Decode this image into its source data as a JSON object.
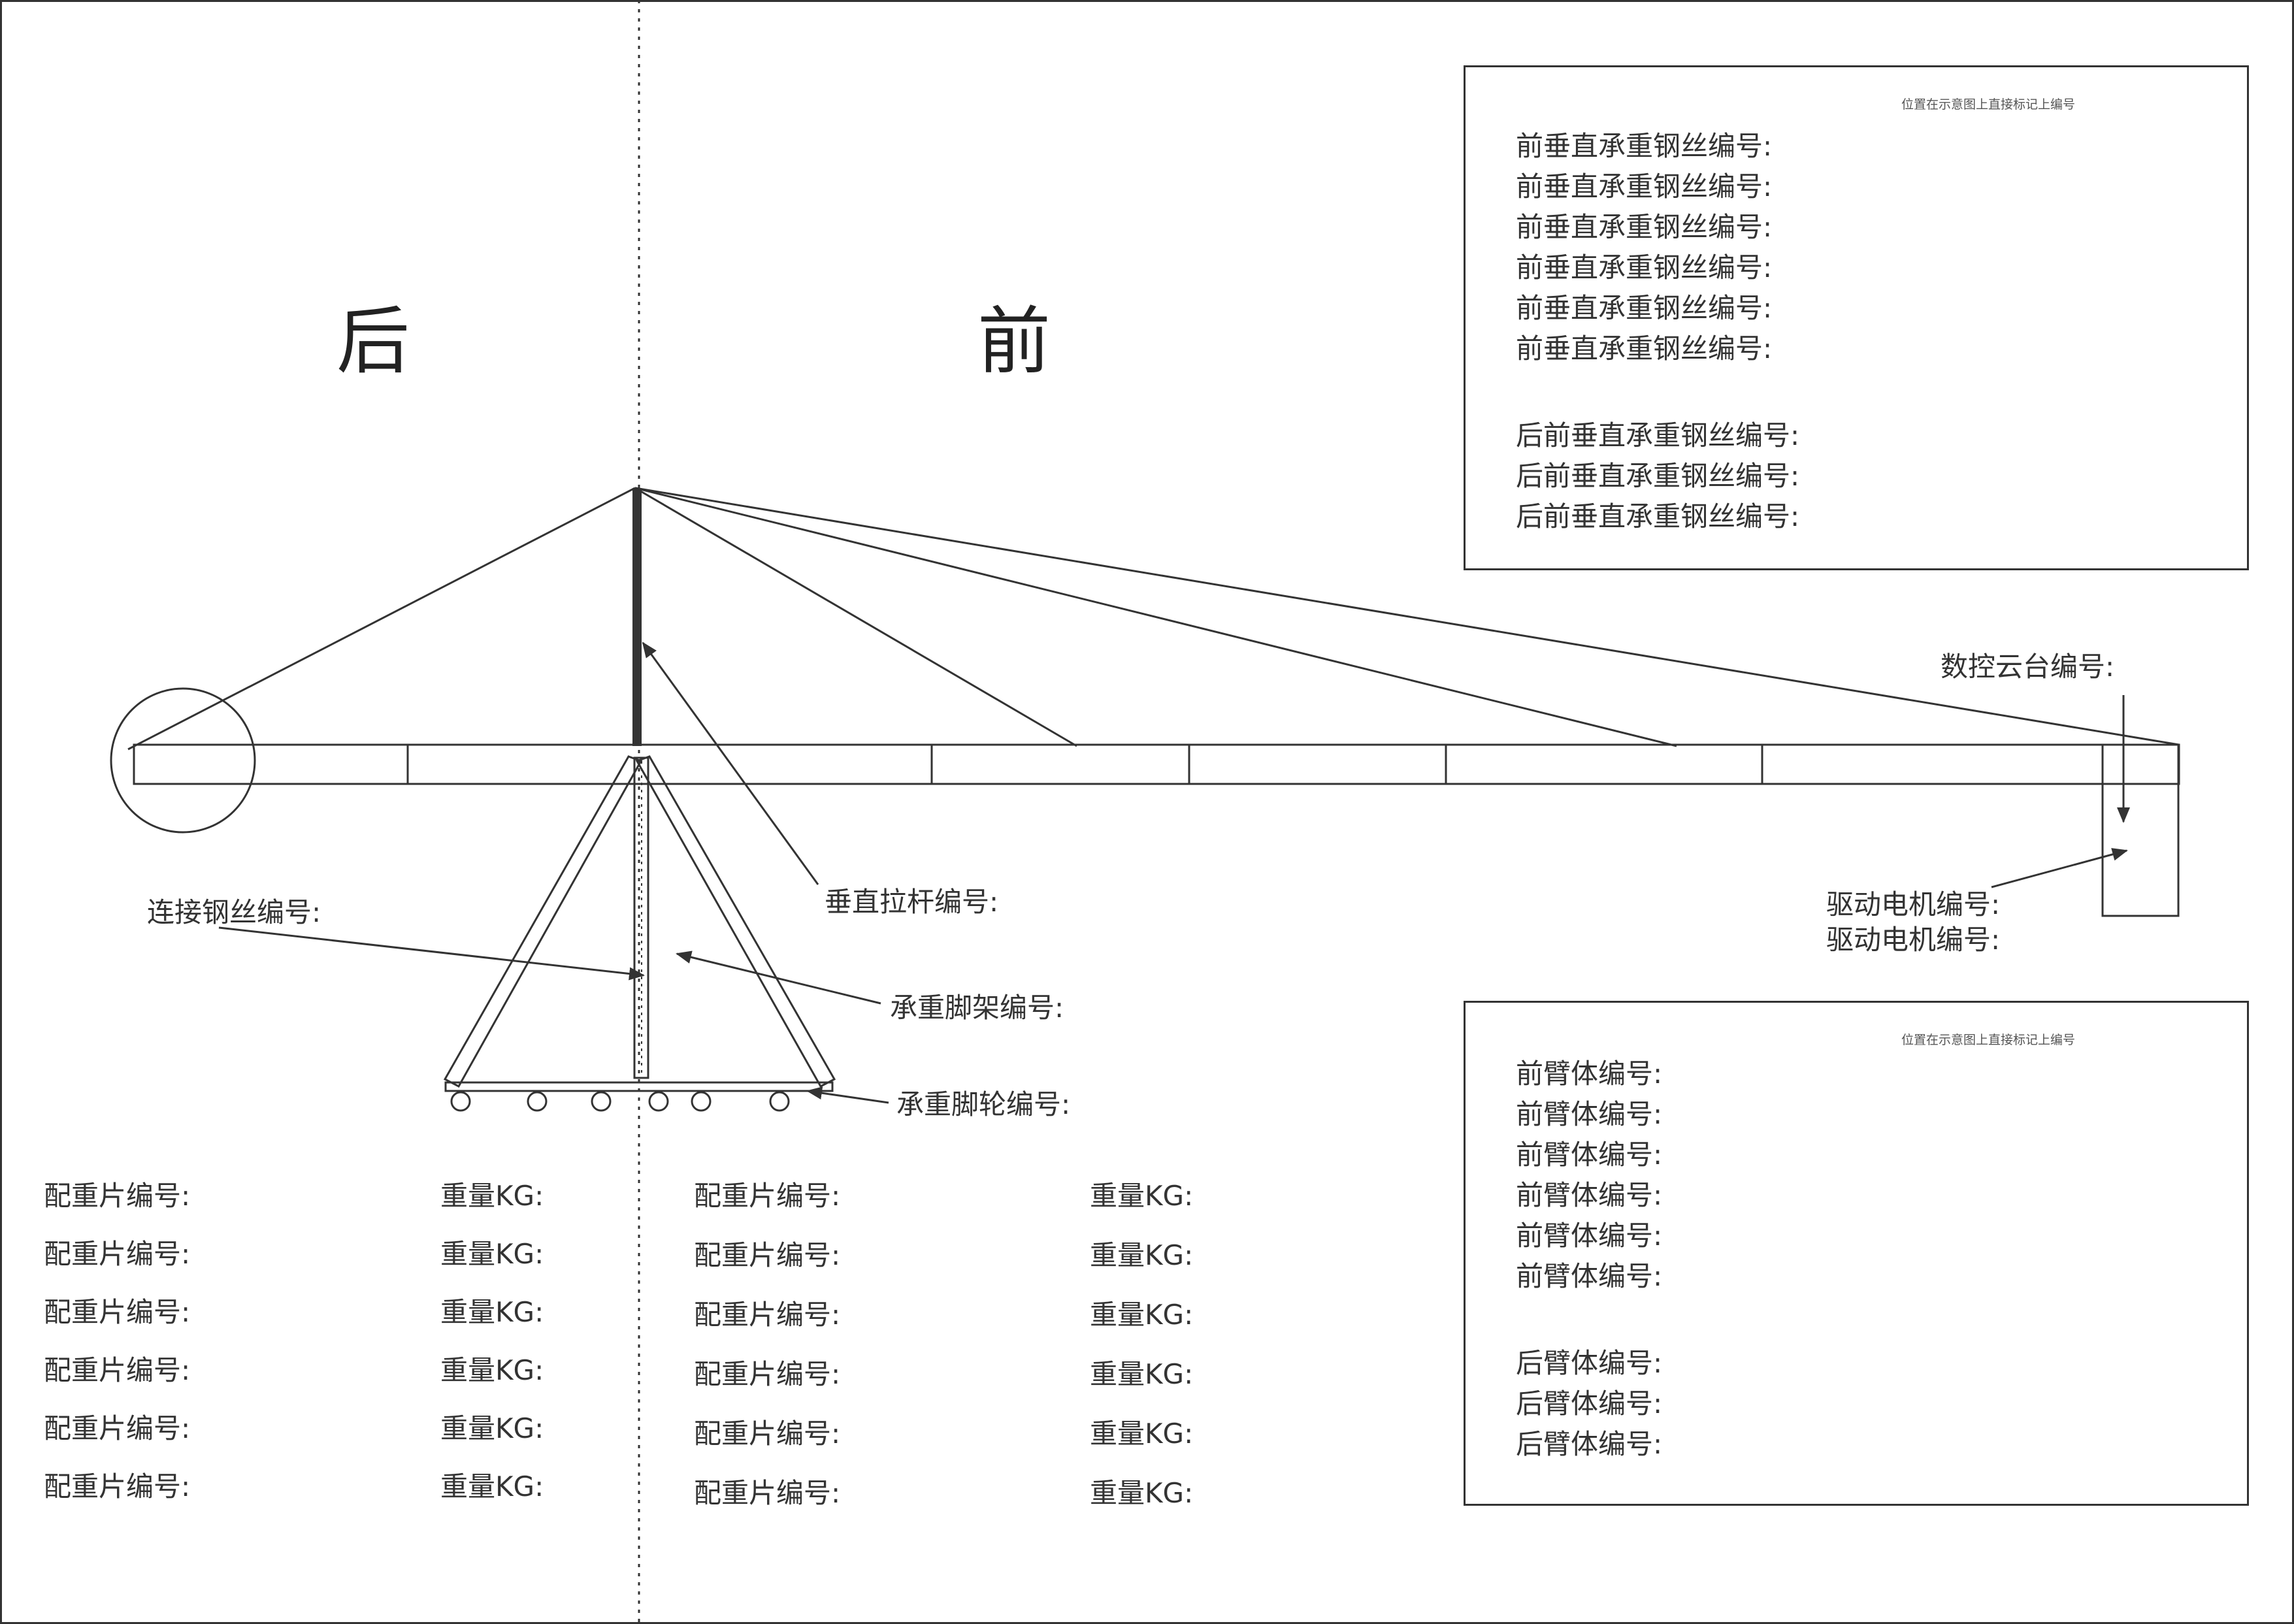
{
  "header": {
    "back_label": "后",
    "front_label": "前"
  },
  "top_box": {
    "note": "位置在示意图上直接标记上编号",
    "front_wire_labels": [
      "前垂直承重钢丝编号:",
      "前垂直承重钢丝编号:",
      "前垂直承重钢丝编号:",
      "前垂直承重钢丝编号:",
      "前垂直承重钢丝编号:",
      "前垂直承重钢丝编号:"
    ],
    "rear_wire_labels": [
      "后前垂直承重钢丝编号:",
      "后前垂直承重钢丝编号:",
      "后前垂直承重钢丝编号:"
    ]
  },
  "bottom_box": {
    "note": "位置在示意图上直接标记上编号",
    "front_arm_labels": [
      "前臂体编号:",
      "前臂体编号:",
      "前臂体编号:",
      "前臂体编号:",
      "前臂体编号:",
      "前臂体编号:"
    ],
    "rear_arm_labels": [
      "后臂体编号:",
      "后臂体编号:",
      "后臂体编号:"
    ]
  },
  "callouts": {
    "cnc_head": "数控云台编号:",
    "drive_motor_1": "驱动电机编号:",
    "drive_motor_2": "驱动电机编号:",
    "connect_wire": "连接钢丝编号:",
    "vertical_rod": "垂直拉杆编号:",
    "tripod": "承重脚架编号:",
    "wheels": "承重脚轮编号:"
  },
  "counterweights": {
    "piece_label": "配重片编号:",
    "weight_label": "重量KG:",
    "left_rows": 6,
    "right_rows": 6
  }
}
